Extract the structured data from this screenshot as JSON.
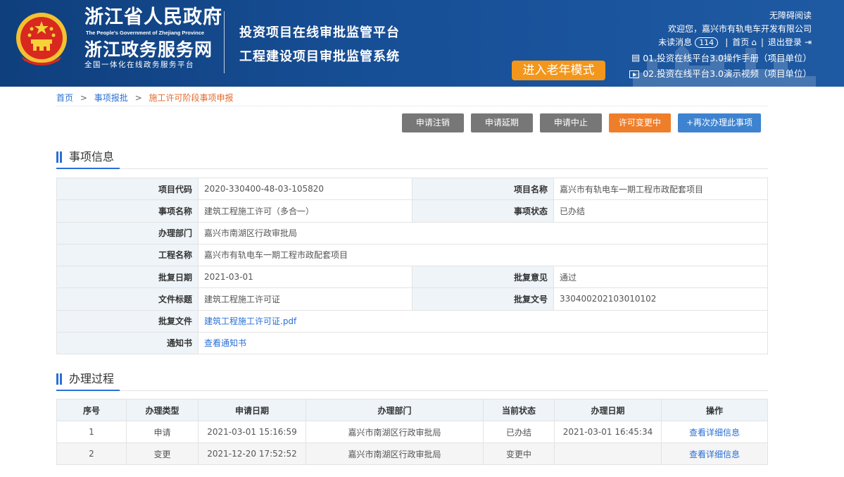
{
  "header": {
    "gov_title": "浙江省人民政府",
    "gov_title_en": "The People's Government of Zhejiang Province",
    "service_title": "浙江政务服务网",
    "service_subtitle": "全国一体化在线政务服务平台",
    "platform_line1": "投资项目在线审批监管平台",
    "platform_line2": "工程建设项目审批监管系统",
    "elder_mode": "进入老年模式",
    "accessibility": "无障碍阅读",
    "welcome": "欢迎您，嘉兴市有轨电车开发有限公司",
    "unread_label": "未读消息",
    "unread_count": "114",
    "home_link": "首页",
    "logout_link": "退出登录",
    "manual_link": "01.投资在线平台3.0操作手册（项目单位）",
    "video_link": "02.投资在线平台3.0演示视频（项目单位）"
  },
  "breadcrumb": {
    "home": "首页",
    "level2": "事项报批",
    "current": "施工许可阶段事项申报"
  },
  "actions": {
    "cancel": "申请注销",
    "extend": "申请延期",
    "suspend": "申请中止",
    "changing": "许可变更中",
    "redo": "+再次办理此事项"
  },
  "sections": {
    "info_title": "事项信息",
    "process_title": "办理过程"
  },
  "info": {
    "project_code_label": "项目代码",
    "project_code": "2020-330400-48-03-105820",
    "project_name_label": "项目名称",
    "project_name": "嘉兴市有轨电车一期工程市政配套项目",
    "item_name_label": "事项名称",
    "item_name": "建筑工程施工许可（多合一）",
    "item_status_label": "事项状态",
    "item_status": "已办结",
    "dept_label": "办理部门",
    "dept": "嘉兴市南湖区行政审批局",
    "eng_name_label": "工程名称",
    "eng_name": "嘉兴市有轨电车一期工程市政配套项目",
    "approve_date_label": "批复日期",
    "approve_date": "2021-03-01",
    "opinion_label": "批复意见",
    "opinion": "通过",
    "doc_title_label": "文件标题",
    "doc_title": "建筑工程施工许可证",
    "doc_no_label": "批复文号",
    "doc_no": "330400202103010102",
    "approve_file_label": "批复文件",
    "approve_file": "建筑工程施工许可证.pdf",
    "notice_label": "通知书",
    "notice_link": "查看通知书"
  },
  "process": {
    "headers": [
      "序号",
      "办理类型",
      "申请日期",
      "办理部门",
      "当前状态",
      "办理日期",
      "操作"
    ],
    "rows": [
      [
        "1",
        "申请",
        "2021-03-01 15:16:59",
        "嘉兴市南湖区行政审批局",
        "已办结",
        "2021-03-01 16:45:34",
        "查看详细信息"
      ],
      [
        "2",
        "变更",
        "2021-12-20 17:52:52",
        "嘉兴市南湖区行政审批局",
        "变更中",
        "",
        "查看详细信息"
      ]
    ]
  },
  "colors": {
    "header_bg": "#174f96",
    "elder_btn": "#f3961c",
    "link": "#2a6fd6",
    "breadcrumb_current": "#e06a2c",
    "btn_gray": "#777777",
    "btn_orange": "#ef7e2b",
    "btn_blue": "#3d83d0"
  }
}
